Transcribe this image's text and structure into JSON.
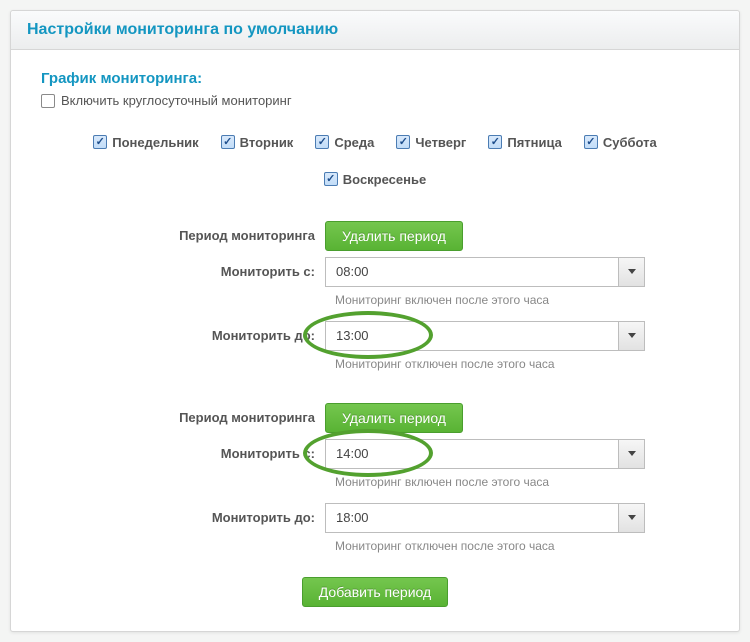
{
  "header": {
    "title": "Настройки мониторинга по умолчанию"
  },
  "section_title": "График мониторинга:",
  "enable_247": {
    "label": "Включить круглосуточный мониторинг",
    "checked": false
  },
  "days": [
    {
      "label": "Понедельник",
      "checked": true
    },
    {
      "label": "Вторник",
      "checked": true
    },
    {
      "label": "Среда",
      "checked": true
    },
    {
      "label": "Четверг",
      "checked": true
    },
    {
      "label": "Пятница",
      "checked": true
    },
    {
      "label": "Суббота",
      "checked": true
    },
    {
      "label": "Воскресенье",
      "checked": true
    }
  ],
  "labels": {
    "period": "Период мониторинга",
    "monitor_from": "Мониторить с:",
    "monitor_to": "Мониторить до:",
    "hint_from": "Мониторинг включен после этого часа",
    "hint_to": "Мониторинг отключен после этого часа",
    "delete_period": "Удалить период",
    "add_period": "Добавить период"
  },
  "periods": [
    {
      "from": "08:00",
      "to": "13:00"
    },
    {
      "from": "14:00",
      "to": "18:00"
    }
  ],
  "highlights": {
    "period0_to": true,
    "period1_from": true
  }
}
